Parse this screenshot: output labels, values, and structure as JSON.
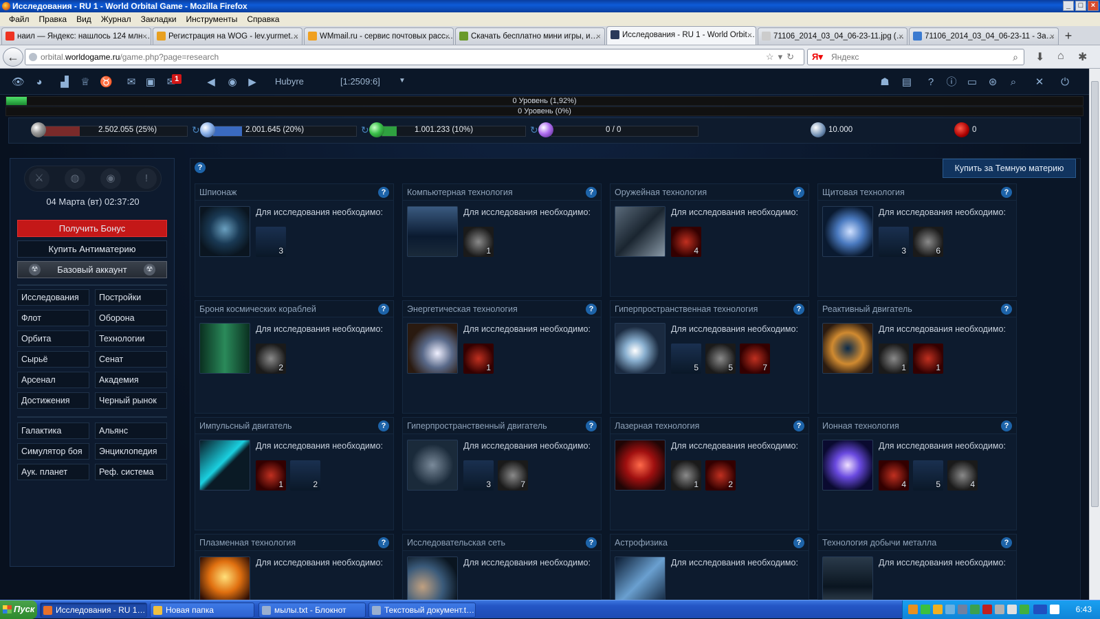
{
  "window": {
    "title": "Исследования - RU 1 - World Orbital Game - Mozilla Firefox"
  },
  "menu": [
    "Файл",
    "Правка",
    "Вид",
    "Журнал",
    "Закладки",
    "Инструменты",
    "Справка"
  ],
  "tabs": [
    {
      "label": "наил — Яндекс: нашлось 124 млн …",
      "color": "#e32"
    },
    {
      "label": "Регистрация на WOG - lev.yurmet…",
      "color": "#e8a020"
    },
    {
      "label": "WMmail.ru - сервис почтовых расс…",
      "color": "#f0a020"
    },
    {
      "label": "Скачать бесплатно мини игры, и…",
      "color": "#6a9a2a"
    },
    {
      "label": "Исследования - RU 1 - World Orbit…",
      "color": "#2a3a5a",
      "active": true
    },
    {
      "label": "71106_2014_03_04_06-23-11.jpg (…",
      "color": "#ccc"
    },
    {
      "label": "71106_2014_03_04_06-23-11 - За…",
      "color": "#3a7ad0"
    }
  ],
  "url": {
    "prefix": "orbital.",
    "domain": "worldogame.ru",
    "path": "/game.php?page=research"
  },
  "search": {
    "placeholder": "Яндекс"
  },
  "game": {
    "player_name": "Hubyre",
    "coords": "[1:2509:6]",
    "mail_count": "1",
    "level1": {
      "text": "0 Уровень (1,92%)",
      "progress": 0.0192
    },
    "level2": {
      "text": "0 Уровень (0%)",
      "progress": 0
    },
    "resources": [
      {
        "name": "metal",
        "text": "2.502.055 (25%)",
        "fill": 0.25,
        "color": "#7a2a2a"
      },
      {
        "name": "crystal",
        "text": "2.001.645 (20%)",
        "fill": 0.2,
        "color": "#3a6ac0"
      },
      {
        "name": "deuterium",
        "text": "1.001.233 (10%)",
        "fill": 0.1,
        "color": "#2fa040"
      },
      {
        "name": "dark-matter",
        "text": "0 / 0",
        "fill": 0,
        "color": "#8a3ac0"
      }
    ],
    "energy": "10.000",
    "antimatter": "0",
    "datetime": "04 Марта (вт) 02:37:20",
    "bonus_btn": "Получить Бонус",
    "buy_antimatter_btn": "Купить Антиматерию",
    "account_btn": "Базовый аккаунт",
    "nav1": [
      "Исследования",
      "Постройки",
      "Флот",
      "Оборона",
      "Орбита",
      "Технологии",
      "Сырьё",
      "Сенат",
      "Арсенал",
      "Академия",
      "Достижения",
      "Черный рынок"
    ],
    "nav2": [
      "Галактика",
      "Альянс",
      "Симулятор боя",
      "Энциклопедия",
      "Аук. планет",
      "Реф. система"
    ],
    "buy_dm_btn": "Купить за Темную материю",
    "need_label": "Для исследования необходимо:",
    "research": [
      {
        "name": "Шпионаж",
        "reqs": [
          "3"
        ]
      },
      {
        "name": "Компьютерная технология",
        "reqs": [
          "1"
        ]
      },
      {
        "name": "Оружейная технология",
        "reqs": [
          "4"
        ]
      },
      {
        "name": "Щитовая технология",
        "reqs": [
          "3",
          "6"
        ]
      },
      {
        "name": "Броня космических кораблей",
        "reqs": [
          "2"
        ]
      },
      {
        "name": "Энергетическая технология",
        "reqs": [
          "1"
        ]
      },
      {
        "name": "Гиперпространственная технология",
        "reqs": [
          "5",
          "5",
          "7"
        ]
      },
      {
        "name": "Реактивный двигатель",
        "reqs": [
          "1",
          "1"
        ]
      },
      {
        "name": "Импульсный двигатель",
        "reqs": [
          "1",
          "2"
        ]
      },
      {
        "name": "Гиперпространственный двигатель",
        "reqs": [
          "3",
          "7"
        ]
      },
      {
        "name": "Лазерная технология",
        "reqs": [
          "1",
          "2"
        ]
      },
      {
        "name": "Ионная технология",
        "reqs": [
          "4",
          "5",
          "4"
        ]
      },
      {
        "name": "Плазменная технология",
        "reqs": []
      },
      {
        "name": "Исследовательская сеть",
        "reqs": []
      },
      {
        "name": "Астрофизика",
        "reqs": []
      },
      {
        "name": "Технология добычи металла",
        "reqs": []
      }
    ]
  },
  "taskbar": {
    "start": "Пуск",
    "items": [
      "Исследования - RU 1…",
      "Новая папка",
      "мылы.txt - Блокнот",
      "Текстовый документ.t…"
    ],
    "clock": "6:43"
  }
}
